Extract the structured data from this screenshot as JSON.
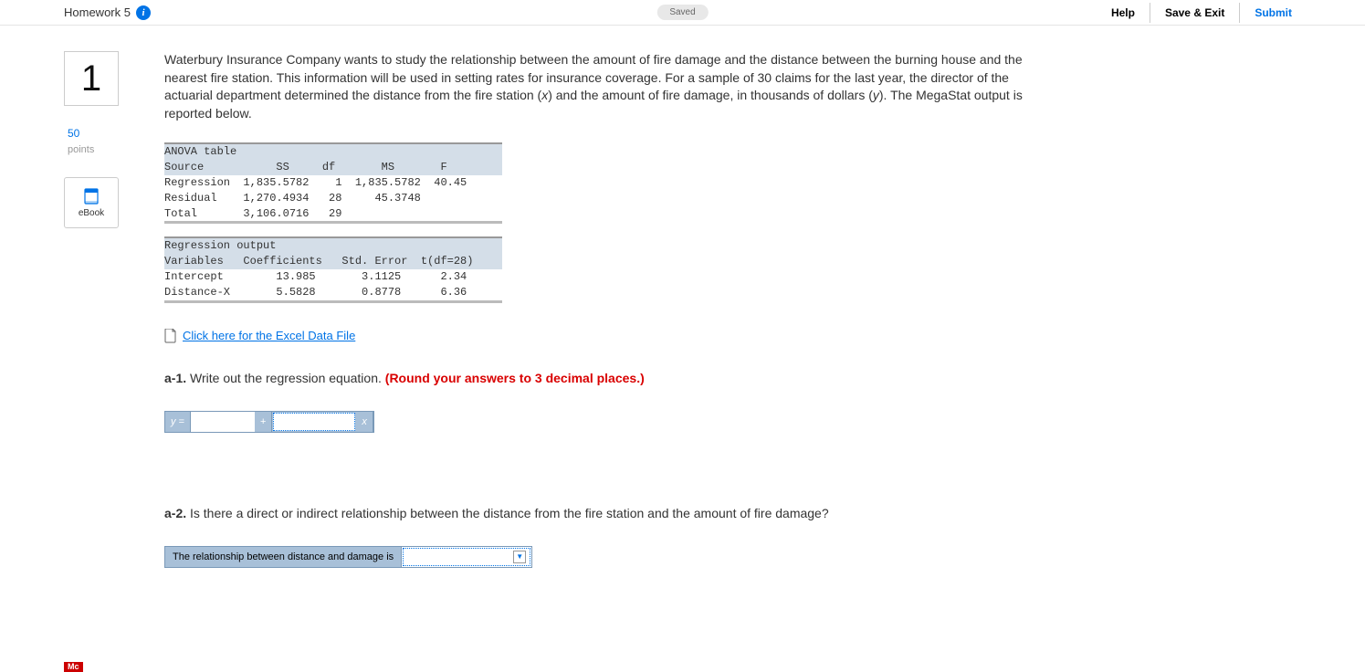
{
  "header": {
    "title": "Homework 5",
    "saved_label": "Saved",
    "help": "Help",
    "save_exit": "Save & Exit",
    "submit": "Submit"
  },
  "sidebar": {
    "question_number": "1",
    "points_value": "50",
    "points_label": "points",
    "ebook_label": "eBook"
  },
  "problem": {
    "text_before_x": "Waterbury Insurance Company wants to study the relationship between the amount of fire damage and the distance between the burning house and the nearest fire station. This information will be used in setting rates for insurance coverage. For a sample of 30 claims for the last year, the director of the actuarial department determined the distance from the fire station (",
    "var_x": "x",
    "text_mid": ") and the amount of fire damage, in thousands of dollars (",
    "var_y": "y",
    "text_after_y": "). The MegaStat output is reported below."
  },
  "anova": {
    "title_line": "ANOVA table",
    "header_line": "Source           SS     df       MS       F",
    "rows": [
      "Regression  1,835.5782    1  1,835.5782  40.45",
      "Residual    1,270.4934   28     45.3748       ",
      "Total       3,106.0716   29                   "
    ]
  },
  "regout": {
    "title_line": "Regression output",
    "header_line": "Variables   Coefficients   Std. Error  t(df=28)",
    "rows": [
      "Intercept        13.985       3.1125      2.34",
      "Distance-X       5.5828       0.8778      6.36"
    ]
  },
  "excel_link": " Click here for the Excel Data File",
  "q_a1": {
    "label": "a-1.",
    "text": " Write out the regression equation. ",
    "instr": "(Round your answers to 3 decimal places.)"
  },
  "eqbar": {
    "y_eq": "y =",
    "plus": "+",
    "x": "x"
  },
  "q_a2": {
    "label": "a-2.",
    "text": " Is there a direct or indirect relationship between the distance from the fire station and the amount of fire damage?"
  },
  "a2_dropdown_label": "The relationship between distance and damage is",
  "footer_badge": "Mc"
}
